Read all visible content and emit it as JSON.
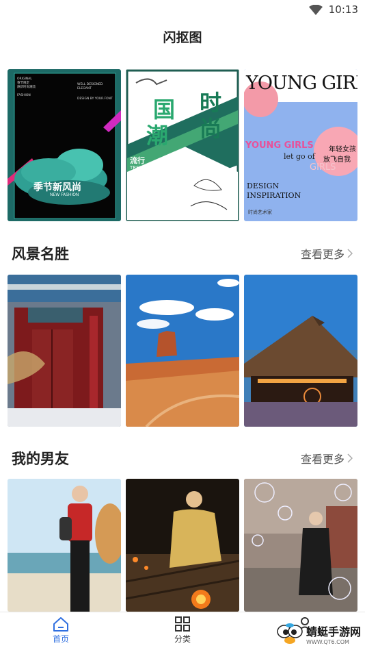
{
  "status": {
    "time": "10:13"
  },
  "app": {
    "title": "闪抠图"
  },
  "featured": {
    "card1": {
      "top_left_lines": [
        "ORIGINAL",
        "春节限定",
        "焕新时尚潮流"
      ],
      "fashion_line": "FASHION",
      "top_right_lines": [
        "WELL DESIGNED",
        "ELEGANT"
      ],
      "design_line": "DESIGN BY YOUR.FONT",
      "headline": "季节新风尚",
      "subline": "NEW FASHION"
    },
    "card2": {
      "big_chars": [
        "时",
        "国",
        "尚",
        "潮"
      ],
      "side_title": "流行",
      "side_en": "TREND",
      "side_cn": "中国时尚",
      "side_small": "2018"
    },
    "card3": {
      "headline": "YOUNG GIRL",
      "sub_en": "YOUNG GIRLS",
      "cn1": "年轻女孩",
      "letgo": "let go of",
      "cn2": "放飞自我",
      "ghost": "GIRLS",
      "design": "DESIGN",
      "inspiration": "INSPIRATION",
      "footer": "时尚艺术家"
    }
  },
  "sections": [
    {
      "title": "风景名胜",
      "more": "查看更多"
    },
    {
      "title": "我的男友",
      "more": "查看更多"
    }
  ],
  "tabs": [
    {
      "label": "首页",
      "active": true
    },
    {
      "label": "分类",
      "active": false
    }
  ],
  "watermark": {
    "title": "蜻蜓手游网",
    "url": "WWW.QT6.COM"
  },
  "colors": {
    "accent": "#2f6fe0",
    "text": "#222222",
    "muted": "#555555"
  }
}
